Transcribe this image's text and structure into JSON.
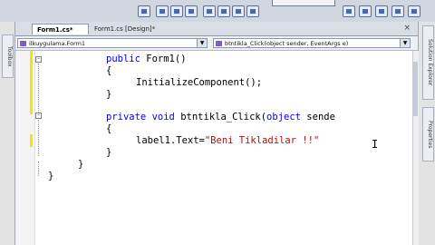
{
  "tabs": {
    "active": "Form1.cs*",
    "inactive": "Form1.cs [Design]*",
    "close": "×"
  },
  "nav": {
    "class_combo": "ilkuygulama.Form1",
    "member_combo": "btntikla_Click(object sender, EventArgs e)",
    "dropdown_glyph": "▼"
  },
  "docks": {
    "left": "Toolbox",
    "right_top": "Solution Explorer",
    "right_bottom": "Properties"
  },
  "code": {
    "line1_kw": "public",
    "line1_rest": " Form1()",
    "line2": "{",
    "line3": "InitializeComponent();",
    "line4": "}",
    "line5_kw1": "private",
    "line5_kw2": "void",
    "line5_mid": " btntikla_Click(",
    "line5_kw3": "object",
    "line5_rest": " sende",
    "line6": "{",
    "line7_pre": "label1.Text=",
    "line7_str": "\"Beni Tikladilar !!\"",
    "line8": "}",
    "line9": "}",
    "line10": "}"
  },
  "colors": {
    "keyword": "#0000ff",
    "string": "#a31515",
    "changed_marker": "#f3e600"
  },
  "icons": [
    "toolbar-button-icon",
    "fold-toggle-icon",
    "class-icon",
    "method-icon",
    "text-cursor-icon"
  ]
}
